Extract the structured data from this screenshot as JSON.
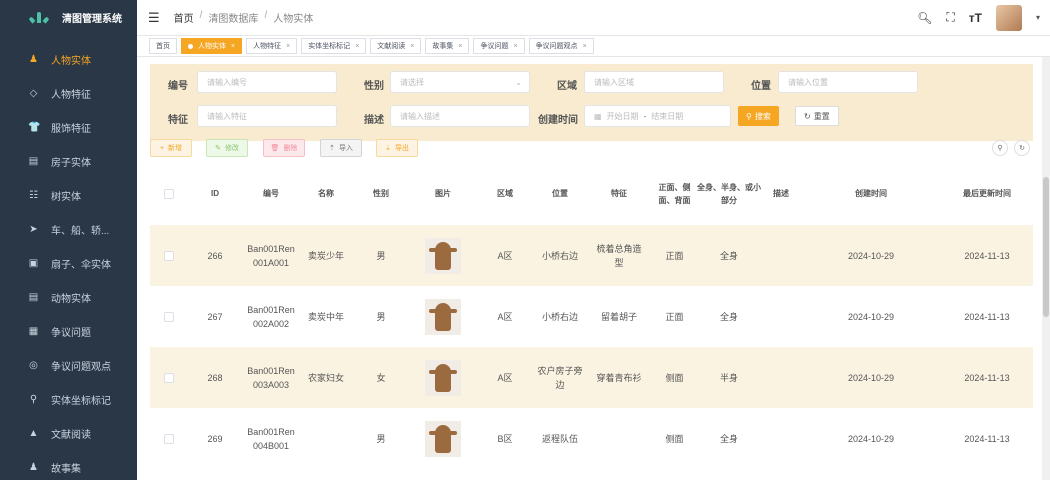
{
  "app": {
    "title": "清图管理系统"
  },
  "sidebar": {
    "items": [
      {
        "label": "人物实体",
        "icon": "person-icon",
        "glyph": "♟",
        "active": true
      },
      {
        "label": "人物特征",
        "icon": "feature-icon",
        "glyph": "◇",
        "active": false
      },
      {
        "label": "服饰特征",
        "icon": "shirt-icon",
        "glyph": "👕",
        "active": false
      },
      {
        "label": "房子实体",
        "icon": "house-icon",
        "glyph": "▤",
        "active": false
      },
      {
        "label": "树实体",
        "icon": "tree-icon",
        "glyph": "☷",
        "active": false
      },
      {
        "label": "车、船、轿...",
        "icon": "send-icon",
        "glyph": "➤",
        "active": false
      },
      {
        "label": "扇子、伞实体",
        "icon": "fan-icon",
        "glyph": "▣",
        "active": false
      },
      {
        "label": "动物实体",
        "icon": "animal-icon",
        "glyph": "▤",
        "active": false
      },
      {
        "label": "争议问题",
        "icon": "question-icon",
        "glyph": "▦",
        "active": false
      },
      {
        "label": "争议问题观点",
        "icon": "opinion-icon",
        "glyph": "◎",
        "active": false
      },
      {
        "label": "实体坐标标记",
        "icon": "pin-icon",
        "glyph": "⚲",
        "active": false
      },
      {
        "label": "文献阅读",
        "icon": "book-icon",
        "glyph": "▲",
        "active": false
      },
      {
        "label": "故事集",
        "icon": "story-icon",
        "glyph": "♟",
        "active": false
      }
    ]
  },
  "header": {
    "breadcrumbs": [
      "首页",
      "清图数据库",
      "人物实体"
    ]
  },
  "tags": [
    {
      "label": "首页",
      "active": false,
      "closable": false
    },
    {
      "label": "人物实体",
      "active": true,
      "closable": true
    },
    {
      "label": "人物特征",
      "active": false,
      "closable": true
    },
    {
      "label": "实体坐标标记",
      "active": false,
      "closable": true
    },
    {
      "label": "文献阅读",
      "active": false,
      "closable": true
    },
    {
      "label": "故事集",
      "active": false,
      "closable": true
    },
    {
      "label": "争议问题",
      "active": false,
      "closable": true
    },
    {
      "label": "争议问题观点",
      "active": false,
      "closable": true
    }
  ],
  "search": {
    "code": {
      "label": "编号",
      "placeholder": "请输入编号"
    },
    "gender": {
      "label": "性别",
      "placeholder": "请选择"
    },
    "area": {
      "label": "区域",
      "placeholder": "请输入区域"
    },
    "position": {
      "label": "位置",
      "placeholder": "请输入位置"
    },
    "feature": {
      "label": "特征",
      "placeholder": "请输入特征"
    },
    "desc": {
      "label": "描述",
      "placeholder": "请输入描述"
    },
    "created": {
      "label": "创建时间",
      "start": "开始日期",
      "sep": "-",
      "end": "结束日期"
    },
    "search_btn": "搜索",
    "reset_btn": "重置"
  },
  "toolbar": {
    "add": "新增",
    "edit": "修改",
    "delete": "删除",
    "import": "导入",
    "export": "导出"
  },
  "table": {
    "headers": {
      "id": "ID",
      "code": "编号",
      "name": "名称",
      "gender": "性别",
      "image": "图片",
      "area": "区域",
      "position": "位置",
      "feature": "特征",
      "facing": "正面、侧面、背面",
      "body": "全身、半身、或小部分",
      "desc": "描述",
      "created": "创建时间",
      "updated": "最后更新时间"
    },
    "rows": [
      {
        "id": "266",
        "code": "Ban001Ren001A001",
        "name": "卖炭少年",
        "gender": "男",
        "area": "A区",
        "position": "小桥右边",
        "feature": "梳着总角造型",
        "facing": "正面",
        "body": "全身",
        "desc": "",
        "created": "2024-10-29",
        "updated": "2024-11-13"
      },
      {
        "id": "267",
        "code": "Ban001Ren002A002",
        "name": "卖炭中年",
        "gender": "男",
        "area": "A区",
        "position": "小桥右边",
        "feature": "留着胡子",
        "facing": "正面",
        "body": "全身",
        "desc": "",
        "created": "2024-10-29",
        "updated": "2024-11-13"
      },
      {
        "id": "268",
        "code": "Ban001Ren003A003",
        "name": "农家妇女",
        "gender": "女",
        "area": "A区",
        "position": "农户房子旁边",
        "feature": "穿着青布衫",
        "facing": "侧面",
        "body": "半身",
        "desc": "",
        "created": "2024-10-29",
        "updated": "2024-11-13"
      },
      {
        "id": "269",
        "code": "Ban001Ren004B001",
        "name": "",
        "gender": "男",
        "area": "B区",
        "position": "返程队伍",
        "feature": "",
        "facing": "侧面",
        "body": "全身",
        "desc": "",
        "created": "2024-10-29",
        "updated": "2024-11-13"
      }
    ]
  },
  "colors": {
    "accent": "#f5a623",
    "sidebar_bg": "#2a3747",
    "search_bg": "#f8ebcf",
    "row_alt": "#fbf3e2"
  }
}
